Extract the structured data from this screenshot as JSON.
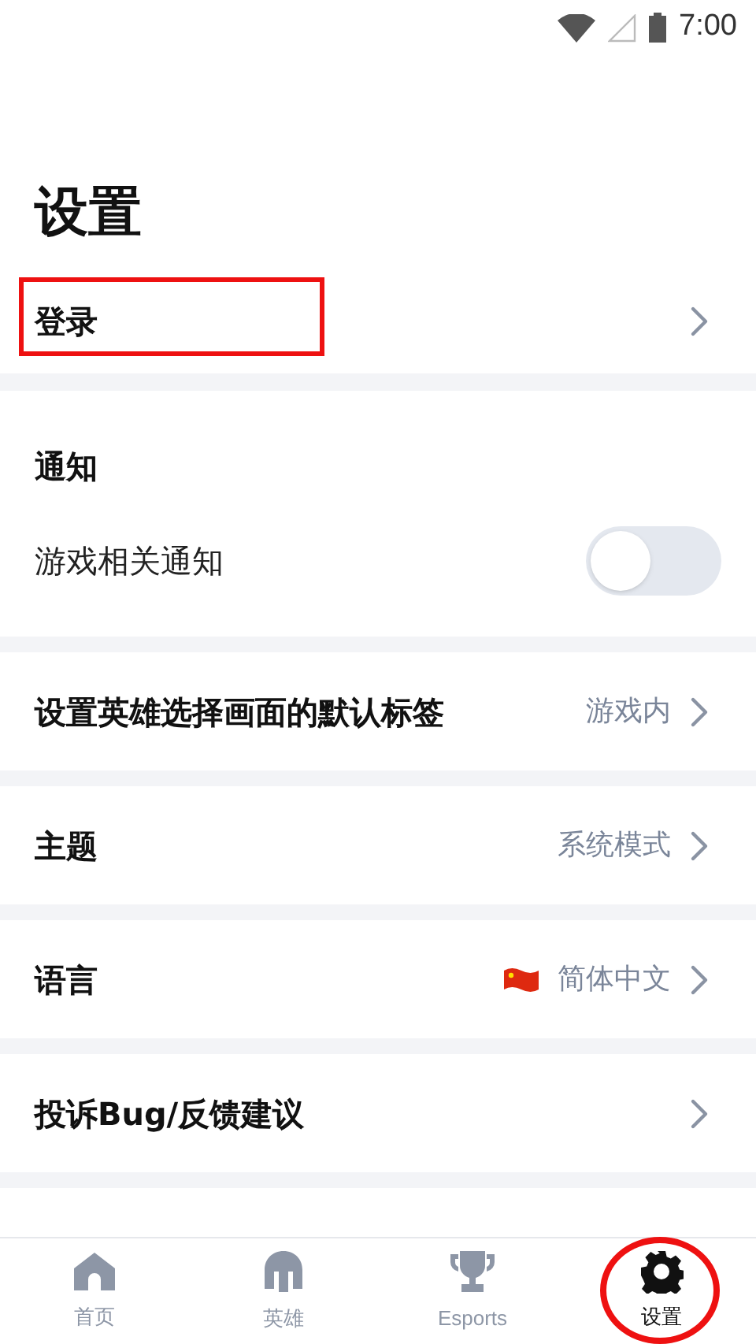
{
  "status_bar": {
    "time": "7:00"
  },
  "title": "设置",
  "sections": [
    {
      "rows": [
        {
          "kind": "link",
          "label": "登录"
        }
      ]
    },
    {
      "rows": [
        {
          "kind": "header",
          "label": "通知"
        },
        {
          "kind": "toggle",
          "label": "游戏相关通知",
          "on": false
        }
      ]
    },
    {
      "rows": [
        {
          "kind": "link",
          "label": "设置英雄选择画面的默认标签",
          "value": "游戏内"
        }
      ]
    },
    {
      "rows": [
        {
          "kind": "link",
          "label": "主题",
          "value": "系统模式"
        }
      ]
    },
    {
      "rows": [
        {
          "kind": "link",
          "label": "语言",
          "value": "简体中文",
          "flag": true
        }
      ]
    },
    {
      "rows": [
        {
          "kind": "link",
          "label": "投诉Bug/反馈建议"
        }
      ]
    }
  ],
  "nav": [
    {
      "label": "首页",
      "selected": false
    },
    {
      "label": "英雄",
      "selected": false
    },
    {
      "label": "Esports",
      "selected": false
    },
    {
      "label": "设置",
      "selected": true
    }
  ]
}
